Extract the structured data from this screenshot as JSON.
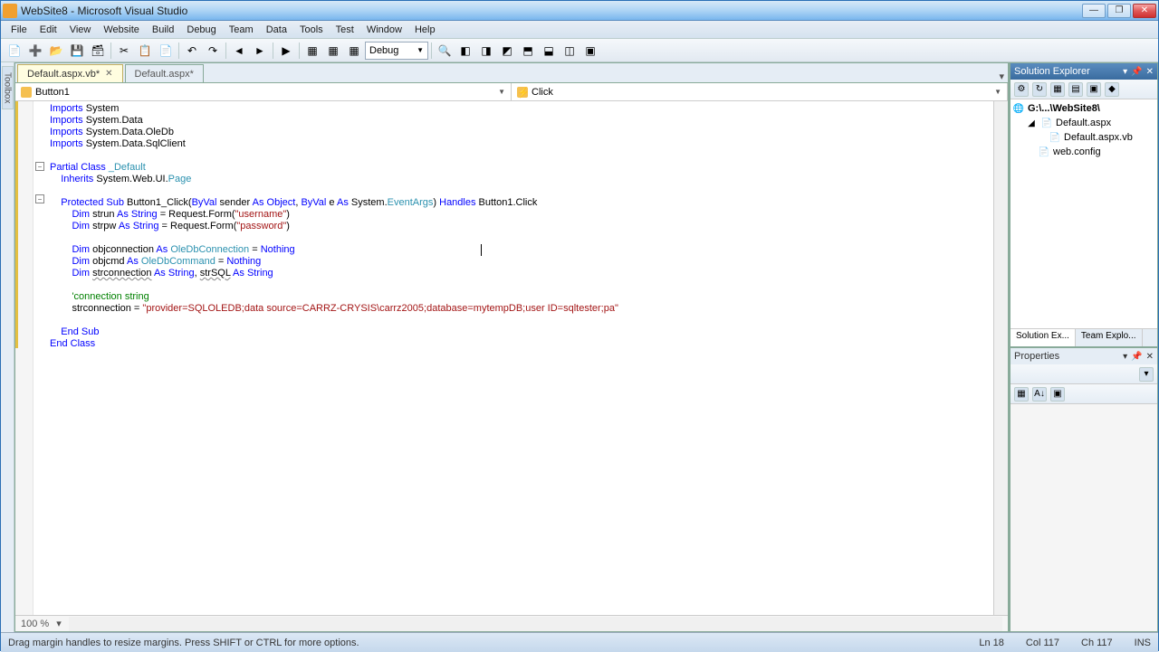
{
  "window": {
    "title": "WebSite8 - Microsoft Visual Studio"
  },
  "menu": [
    "File",
    "Edit",
    "View",
    "Website",
    "Build",
    "Debug",
    "Team",
    "Data",
    "Tools",
    "Test",
    "Window",
    "Help"
  ],
  "toolbar": {
    "config": "Debug"
  },
  "tabs": [
    {
      "label": "Default.aspx.vb*",
      "active": true
    },
    {
      "label": "Default.aspx*",
      "active": false
    }
  ],
  "dropdowns": {
    "left": "Button1",
    "right": "Click"
  },
  "code": {
    "l1a": "Imports",
    "l1b": " System",
    "l2a": "Imports",
    "l2b": " System.Data",
    "l3a": "Imports",
    "l3b": " System.Data.OleDb",
    "l4a": "Imports",
    "l4b": " System.Data.SqlClient",
    "l6a": "Partial",
    "l6b": " ",
    "l6c": "Class",
    "l6d": " ",
    "l6e": "_Default",
    "l7a": "    ",
    "l7b": "Inherits",
    "l7c": " System.Web.UI.",
    "l7d": "Page",
    "l9a": "    ",
    "l9b": "Protected",
    "l9c": " ",
    "l9d": "Sub",
    "l9e": " Button1_Click(",
    "l9f": "ByVal",
    "l9g": " sender ",
    "l9h": "As",
    "l9i": " ",
    "l9j": "Object",
    "l9k": ", ",
    "l9l": "ByVal",
    "l9m": " e ",
    "l9n": "As",
    "l9o": " System.",
    "l9p": "EventArgs",
    "l9q": ") ",
    "l9r": "Handles",
    "l9s": " Button1.Click",
    "l10a": "        ",
    "l10b": "Dim",
    "l10c": " strun ",
    "l10d": "As",
    "l10e": " ",
    "l10f": "String",
    "l10g": " = Request.Form(",
    "l10h": "\"username\"",
    "l10i": ")",
    "l11a": "        ",
    "l11b": "Dim",
    "l11c": " strpw ",
    "l11d": "As",
    "l11e": " ",
    "l11f": "String",
    "l11g": " = Request.Form(",
    "l11h": "\"password\"",
    "l11i": ")",
    "l13a": "        ",
    "l13b": "Dim",
    "l13c": " objconnection ",
    "l13d": "As",
    "l13e": " ",
    "l13f": "OleDbConnection",
    "l13g": " = ",
    "l13h": "Nothing",
    "l14a": "        ",
    "l14b": "Dim",
    "l14c": " objcmd ",
    "l14d": "As",
    "l14e": " ",
    "l14f": "OleDbCommand",
    "l14g": " = ",
    "l14h": "Nothing",
    "l15a": "        ",
    "l15b": "Dim",
    "l15c": " ",
    "l15d": "strconnection",
    "l15e": " ",
    "l15f": "As",
    "l15g": " ",
    "l15h": "String",
    "l15i": ", ",
    "l15j": "strSQL",
    "l15k": " ",
    "l15l": "As",
    "l15m": " ",
    "l15n": "String",
    "l17a": "        ",
    "l17b": "'connection string",
    "l18a": "        strconnection = ",
    "l18b": "\"provider=SQLOLEDB;data source=CARRZ-CRYSIS\\carrz2005;database=mytempDB;user ID=sqltester;pa\"",
    "l20a": "    ",
    "l20b": "End",
    "l20c": " ",
    "l20d": "Sub",
    "l21a": "End",
    "l21b": " ",
    "l21c": "Class"
  },
  "editor_status": {
    "zoom": "100 %"
  },
  "solution_explorer": {
    "title": "Solution Explorer",
    "root": "G:\\...\\WebSite8\\",
    "items": [
      {
        "label": "Default.aspx",
        "indent": 1,
        "expandable": true
      },
      {
        "label": "Default.aspx.vb",
        "indent": 2,
        "expandable": false
      },
      {
        "label": "web.config",
        "indent": 1,
        "expandable": false
      }
    ],
    "bottom_tabs": [
      "Solution Ex...",
      "Team Explo..."
    ]
  },
  "properties": {
    "title": "Properties"
  },
  "statusbar": {
    "left": "Drag margin handles to resize margins. Press SHIFT or CTRL for more options.",
    "ln": "Ln 18",
    "col": "Col 117",
    "ch": "Ch 117",
    "ins": "INS"
  }
}
